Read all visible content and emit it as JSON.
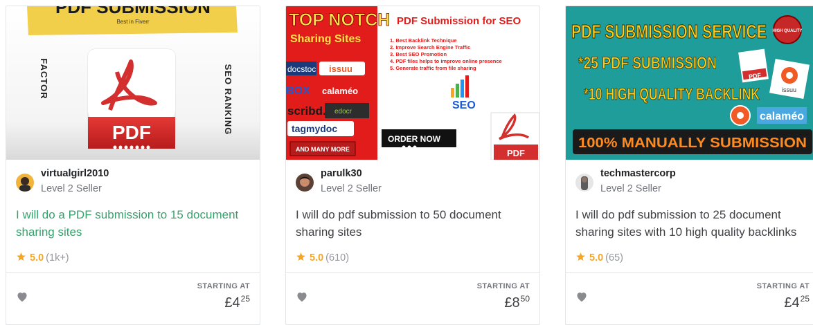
{
  "gigs": [
    {
      "thumbnail": {
        "banner_text": "PDF SUBMISSION",
        "banner_sub": "Best in Fiverr",
        "left_vertical": "FACTOR",
        "right_vertical": "SEO RANKING",
        "pdf_label": "PDF"
      },
      "seller_name": "virtualgirl2010",
      "seller_level": "Level 2 Seller",
      "title": "I will do a PDF submission to 15 document sharing sites",
      "rating": "5.0",
      "rating_count": "(1k+)",
      "starting_label": "STARTING AT",
      "price_main": "£4",
      "price_cents": "25",
      "title_color": "#37a16e",
      "icons": {
        "star": "star-icon",
        "heart": "heart-icon"
      }
    },
    {
      "thumbnail": {
        "headline_1": "TOP NOTCH",
        "headline_2": "Sharing Sites",
        "right_title": "PDF Submission for SEO",
        "list": [
          "1.  Best Backlink Technique",
          "2.  Improve Search Engine Traffic",
          "3.  Best SEO Promotion",
          "4.  PDF files helps to improve online presence",
          "5.  Generate traffic from file sharing"
        ],
        "logos": [
          "docstoc",
          "issuu",
          "BOX",
          "calaméo",
          "scribd.",
          "edocr",
          "tagmydoc"
        ],
        "and_many_more": "AND MANY MORE",
        "order_now": "ORDER NOW",
        "seo_label": "SEO",
        "pdf_label": "PDF"
      },
      "seller_name": "parulk30",
      "seller_level": "Level 2 Seller",
      "title": "I will do pdf submission to 50 document sharing sites",
      "rating": "5.0",
      "rating_count": "(610)",
      "starting_label": "STARTING AT",
      "price_main": "£8",
      "price_cents": "50"
    },
    {
      "thumbnail": {
        "headline": "PDF SUBMISSION SERVICE",
        "line_1": "*25 PDF SUBMISSION",
        "line_2": "*10 HIGH QUALITY BACKLINK",
        "bottom_banner": "100% MANUALLY SUBMISSION",
        "badge": "HIGH QUALITY",
        "pdf_label": "PDF",
        "issuu_label": "issuu",
        "calameo_label": "calaméo"
      },
      "seller_name": "techmastercorp",
      "seller_level": "Level 2 Seller",
      "title": "I will do pdf submission to 25 document sharing sites with 10 high quality backlinks",
      "rating": "5.0",
      "rating_count": "(65)",
      "starting_label": "STARTING AT",
      "price_main": "£4",
      "price_cents": "25"
    }
  ],
  "colors": {
    "star": "#f5a623",
    "heart": "#8a8b8f",
    "card_border": "#e4e5e7",
    "thumb2_red": "#e21b1b",
    "thumb3_teal": "#1f9d9a"
  }
}
